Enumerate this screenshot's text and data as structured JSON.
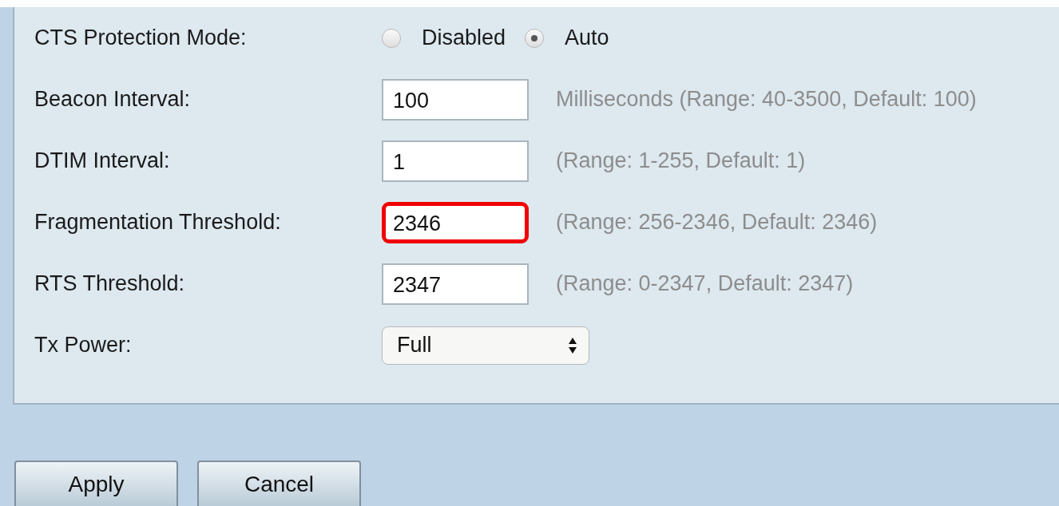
{
  "settings": [
    {
      "kind": "radio",
      "label": "CTS Protection Mode:",
      "options": [
        {
          "label": "Disabled",
          "selected": false
        },
        {
          "label": "Auto",
          "selected": true
        }
      ]
    },
    {
      "kind": "text",
      "label": "Beacon Interval:",
      "value": "100",
      "highlighted": false,
      "hint": "Milliseconds (Range: 40-3500, Default: 100)"
    },
    {
      "kind": "text",
      "label": "DTIM Interval:",
      "value": "1",
      "highlighted": false,
      "hint": "(Range: 1-255, Default: 1)"
    },
    {
      "kind": "text",
      "label": "Fragmentation Threshold:",
      "value": "2346",
      "highlighted": true,
      "hint": "(Range: 256-2346, Default: 2346)"
    },
    {
      "kind": "text",
      "label": "RTS Threshold:",
      "value": "2347",
      "highlighted": false,
      "hint": "(Range: 0-2347, Default: 2347)"
    },
    {
      "kind": "select",
      "label": "Tx Power:",
      "value": "Full"
    }
  ],
  "buttons": [
    "Apply",
    "Cancel"
  ]
}
